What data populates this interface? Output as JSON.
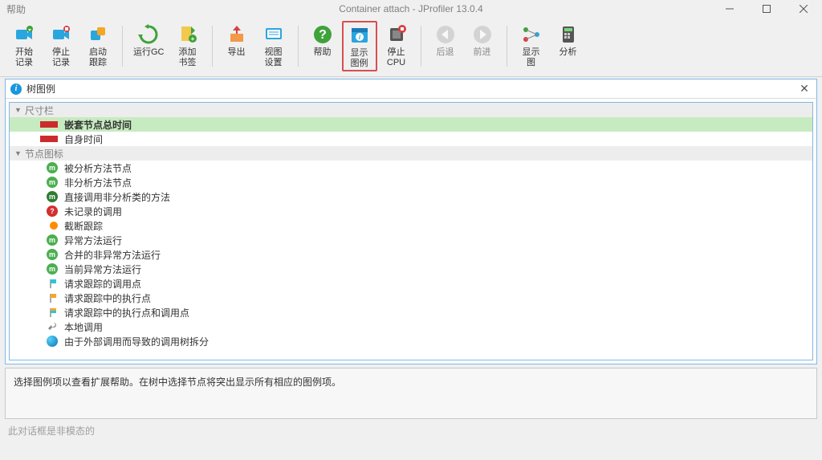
{
  "titlebar": {
    "menu": "帮助",
    "title": "Container attach - JProfiler 13.0.4"
  },
  "toolbar": [
    {
      "id": "start-rec",
      "label": "开始\n记录",
      "icon": "cam-green"
    },
    {
      "id": "stop-rec",
      "label": "停止\n记录",
      "icon": "cam-red"
    },
    {
      "id": "start-track",
      "label": "启动\n跟踪",
      "icon": "tracker"
    },
    {
      "sep": true
    },
    {
      "id": "run-gc",
      "label": "运行GC",
      "icon": "recycle"
    },
    {
      "id": "add-bookmark",
      "label": "添加\n书签",
      "icon": "bookmark"
    },
    {
      "sep": true
    },
    {
      "id": "export",
      "label": "导出",
      "icon": "export"
    },
    {
      "id": "view-settings",
      "label": "视图\n设置",
      "icon": "settings"
    },
    {
      "sep": true
    },
    {
      "id": "help",
      "label": "帮助",
      "icon": "help"
    },
    {
      "id": "show-legend",
      "label": "显示\n图例",
      "icon": "info-win",
      "active": true
    },
    {
      "id": "stop-cpu",
      "label": "停止\nCPU",
      "icon": "cpu"
    },
    {
      "sep": true
    },
    {
      "id": "back",
      "label": "后退",
      "icon": "arrow-left",
      "disabled": true
    },
    {
      "id": "forward",
      "label": "前进",
      "icon": "arrow-right",
      "disabled": true
    },
    {
      "sep": true
    },
    {
      "id": "show-graph",
      "label": "显示\n图",
      "icon": "graph"
    },
    {
      "id": "analyze",
      "label": "分析",
      "icon": "calc"
    }
  ],
  "panel": {
    "title": "树图例",
    "sections": [
      {
        "head": "尺寸栏",
        "rows": [
          {
            "icon": "bar-red",
            "text": "嵌套节点总时间",
            "selected": true
          },
          {
            "icon": "bar-red",
            "text": "自身时间"
          }
        ]
      },
      {
        "head": "节点图标",
        "rows": [
          {
            "icon": "m-green",
            "text": "被分析方法节点"
          },
          {
            "icon": "m-green",
            "text": "非分析方法节点"
          },
          {
            "icon": "m-green-dark",
            "text": "直接调用非分析类的方法"
          },
          {
            "icon": "q-red",
            "text": "未记录的调用"
          },
          {
            "icon": "dot-orange",
            "text": "截断跟踪"
          },
          {
            "icon": "m-green",
            "text": "异常方法运行"
          },
          {
            "icon": "m-green",
            "text": "合并的非异常方法运行"
          },
          {
            "icon": "m-green",
            "text": "当前异常方法运行"
          },
          {
            "icon": "flag-cyan",
            "text": "请求跟踪的调用点"
          },
          {
            "icon": "flag-orange",
            "text": "请求跟踪中的执行点"
          },
          {
            "icon": "flag-split",
            "text": "请求跟踪中的执行点和调用点"
          },
          {
            "icon": "wrench",
            "text": "本地调用"
          },
          {
            "icon": "globe",
            "text": "由于外部调用而导致的调用树拆分"
          }
        ]
      }
    ]
  },
  "hint": "选择图例项以查看扩展帮助。在树中选择节点将突出显示所有相应的图例项。",
  "status": "此对话框是非模态的"
}
